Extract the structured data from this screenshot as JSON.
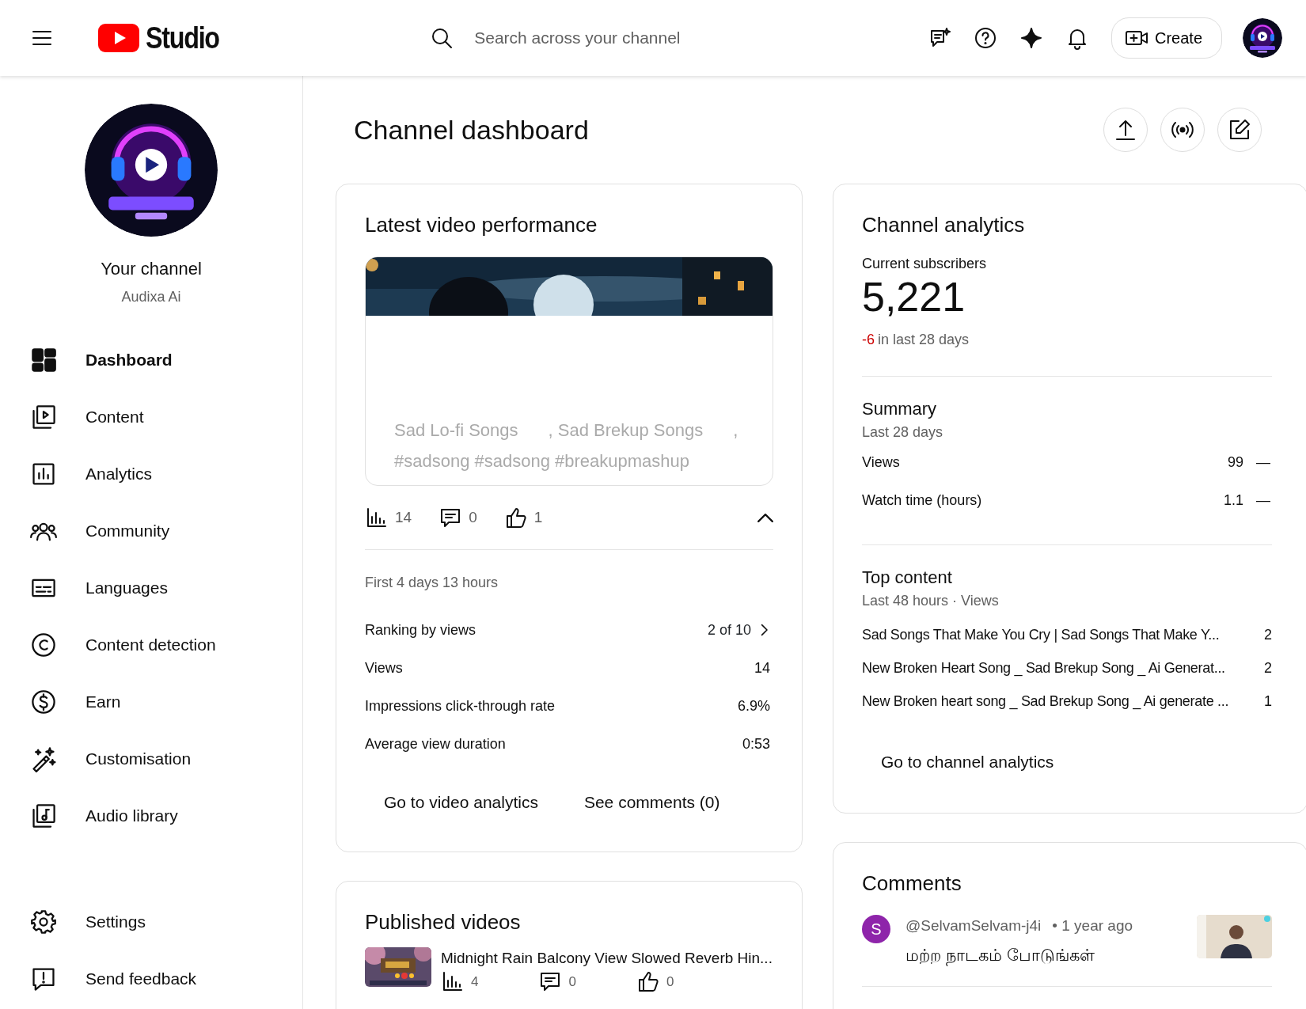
{
  "header": {
    "logo_text": "Studio",
    "search": {
      "placeholder": "Search across your channel"
    },
    "create_label": "Create"
  },
  "sidebar": {
    "channel_label": "Your channel",
    "channel_name": "Audixa Ai",
    "items": [
      {
        "label": "Dashboard",
        "selected": true
      },
      {
        "label": "Content",
        "selected": false
      },
      {
        "label": "Analytics",
        "selected": false
      },
      {
        "label": "Community",
        "selected": false
      },
      {
        "label": "Languages",
        "selected": false
      },
      {
        "label": "Content detection",
        "selected": false
      },
      {
        "label": "Earn",
        "selected": false
      },
      {
        "label": "Customisation",
        "selected": false
      },
      {
        "label": "Audio library",
        "selected": false
      }
    ],
    "footer_items": [
      {
        "label": "Settings"
      },
      {
        "label": "Send feedback"
      }
    ]
  },
  "page_title": "Channel dashboard",
  "latest_video": {
    "title": "Latest video performance",
    "tags_line": [
      "Sad Lo-fi Songs",
      ", Sad Brekup Songs",
      ","
    ],
    "hashtags": "#sadsong #sadsong #breakupmashup",
    "stats": {
      "views": "14",
      "comments": "0",
      "likes": "1"
    },
    "expanded": true,
    "period": "First 4 days 13 hours",
    "metrics": [
      {
        "label": "Ranking by views",
        "value": "2 of 10",
        "kind": "link"
      },
      {
        "label": "Views",
        "value": "14",
        "kind": "plain"
      },
      {
        "label": "Impressions click-through rate",
        "value": "6.9%",
        "kind": "plain"
      },
      {
        "label": "Average view duration",
        "value": "0:53",
        "kind": "plain"
      }
    ],
    "actions": [
      "Go to video analytics",
      "See comments (0)"
    ]
  },
  "published_videos": {
    "title": "Published videos",
    "items": [
      {
        "title": "Midnight Rain Balcony View Slowed Reverb Hin...",
        "views": "4",
        "comments": "0",
        "likes": "0"
      }
    ]
  },
  "channel_analytics": {
    "title": "Channel analytics",
    "subscribers_label": "Current subscribers",
    "subscribers": "5,221",
    "change": "-6",
    "change_text": "in last 28 days",
    "summary": {
      "title": "Summary",
      "subtitle": "Last 28 days",
      "rows": [
        {
          "label": "Views",
          "value": "99",
          "trend": "—"
        },
        {
          "label": "Watch time (hours)",
          "value": "1.1",
          "trend": "—"
        }
      ]
    },
    "top_content": {
      "title": "Top content",
      "subtitle": "Last 48 hours · Views",
      "rows": [
        {
          "title": "Sad Songs That Make You Cry | Sad Songs That Make Y...",
          "views": "2"
        },
        {
          "title": "New Broken Heart Song _ Sad Brekup Song _ Ai Generat...",
          "views": "2"
        },
        {
          "title": "New Broken heart song _ Sad Brekup Song _ Ai generate ...",
          "views": "1"
        }
      ]
    },
    "action": "Go to channel analytics"
  },
  "comments": {
    "title": "Comments",
    "items": [
      {
        "initial": "S",
        "color": "#8e24aa",
        "author": "@SelvamSelvam-j4i",
        "time": "• 1 year ago",
        "text": "மற்ற நாடகம் போடுங்கள்"
      }
    ]
  }
}
